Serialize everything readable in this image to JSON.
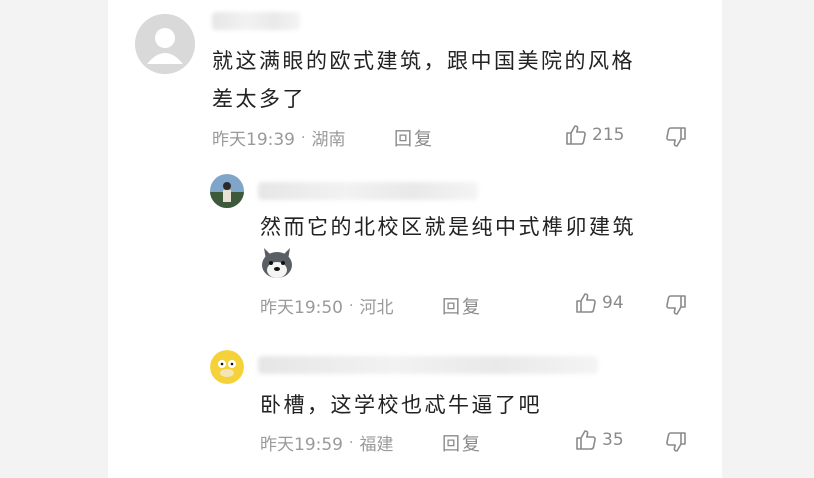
{
  "comments": [
    {
      "text_lines": [
        "就这满眼的欧式建筑，跟中国美院的风格",
        "差太多了"
      ],
      "time": "昨天19:39",
      "location": "湖南",
      "reply_label": "回复",
      "likes": "215",
      "avatar_icon": "default-avatar-icon"
    },
    {
      "text_lines": [
        "然而它的北校区就是纯中式榫卯建筑"
      ],
      "emoji": "husky-dog-emoji",
      "time": "昨天19:50",
      "location": "河北",
      "reply_label": "回复",
      "likes": "94",
      "avatar_icon": "photo-avatar"
    },
    {
      "text_lines": [
        "卧槽，这学校也忒牛逼了吧"
      ],
      "time": "昨天19:59",
      "location": "福建",
      "reply_label": "回复",
      "likes": "35",
      "avatar_icon": "psyduck-avatar"
    }
  ],
  "separator": "·",
  "colors": {
    "text": "#222222",
    "meta": "#9a9a9a",
    "background": "#ffffff",
    "page_background": "#f3f3f3"
  }
}
